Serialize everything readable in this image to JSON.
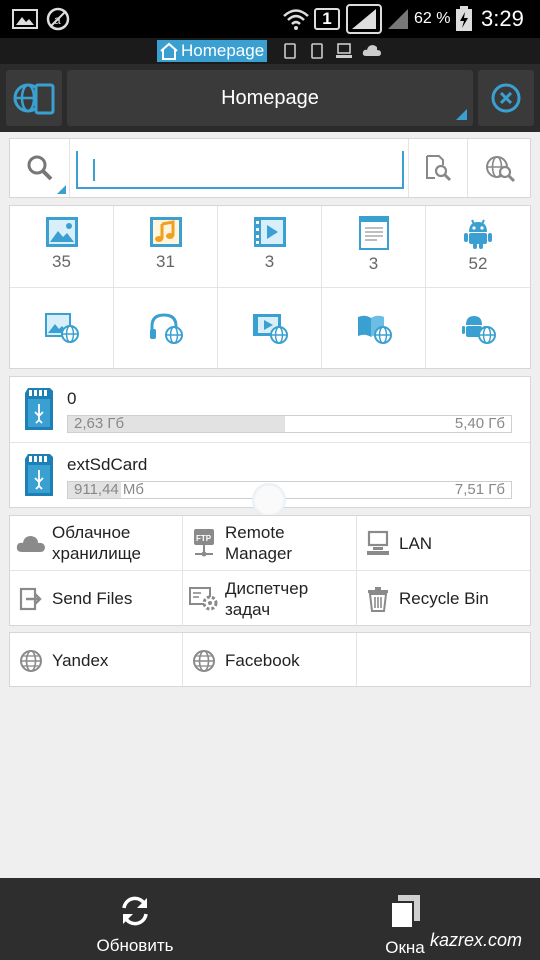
{
  "status_bar": {
    "sim_label": "1",
    "battery": "62 %",
    "time": "3:29"
  },
  "window_bar": {
    "active_window": "Homepage"
  },
  "title_bar": {
    "title": "Homepage"
  },
  "search": {
    "value": "",
    "placeholder": ""
  },
  "categories": [
    {
      "icon": "image-icon",
      "count": "35"
    },
    {
      "icon": "music-icon",
      "count": "31"
    },
    {
      "icon": "video-icon",
      "count": "3"
    },
    {
      "icon": "document-icon",
      "count": "3"
    },
    {
      "icon": "android-icon",
      "count": "52"
    },
    {
      "icon": "web-image-icon",
      "count": ""
    },
    {
      "icon": "web-music-icon",
      "count": ""
    },
    {
      "icon": "web-video-icon",
      "count": ""
    },
    {
      "icon": "web-book-icon",
      "count": ""
    },
    {
      "icon": "web-android-icon",
      "count": ""
    }
  ],
  "storage": [
    {
      "name": "0",
      "used": "2,63 Гб",
      "total": "5,40 Гб",
      "used_fraction": 0.49
    },
    {
      "name": "extSdCard",
      "used": "911,44 Мб",
      "total": "7,51 Гб",
      "used_fraction": 0.12
    }
  ],
  "tools": [
    {
      "label_line1": "Облачное",
      "label_line2": "хранилище",
      "icon": "cloud-icon"
    },
    {
      "label_line1": "Remote",
      "label_line2": "Manager",
      "icon": "ftp-icon"
    },
    {
      "label_line1": "LAN",
      "label_line2": "",
      "icon": "lan-icon"
    },
    {
      "label_line1": "Send Files",
      "label_line2": "",
      "icon": "send-files-icon"
    },
    {
      "label_line1": "Диспетчер",
      "label_line2": "задач",
      "icon": "task-manager-icon"
    },
    {
      "label_line1": "Recycle Bin",
      "label_line2": "",
      "icon": "trash-icon"
    }
  ],
  "bookmarks": [
    {
      "label": "Yandex",
      "icon": "globe-icon"
    },
    {
      "label": "Facebook",
      "icon": "globe-icon"
    }
  ],
  "bottom_bar": {
    "refresh_label": "Обновить",
    "windows_label": "Окна"
  },
  "watermark": "kazrex.com",
  "colors": {
    "accent": "#3aa0d2",
    "music": "#f0a020",
    "bar_dark": "#2b2b2b"
  }
}
